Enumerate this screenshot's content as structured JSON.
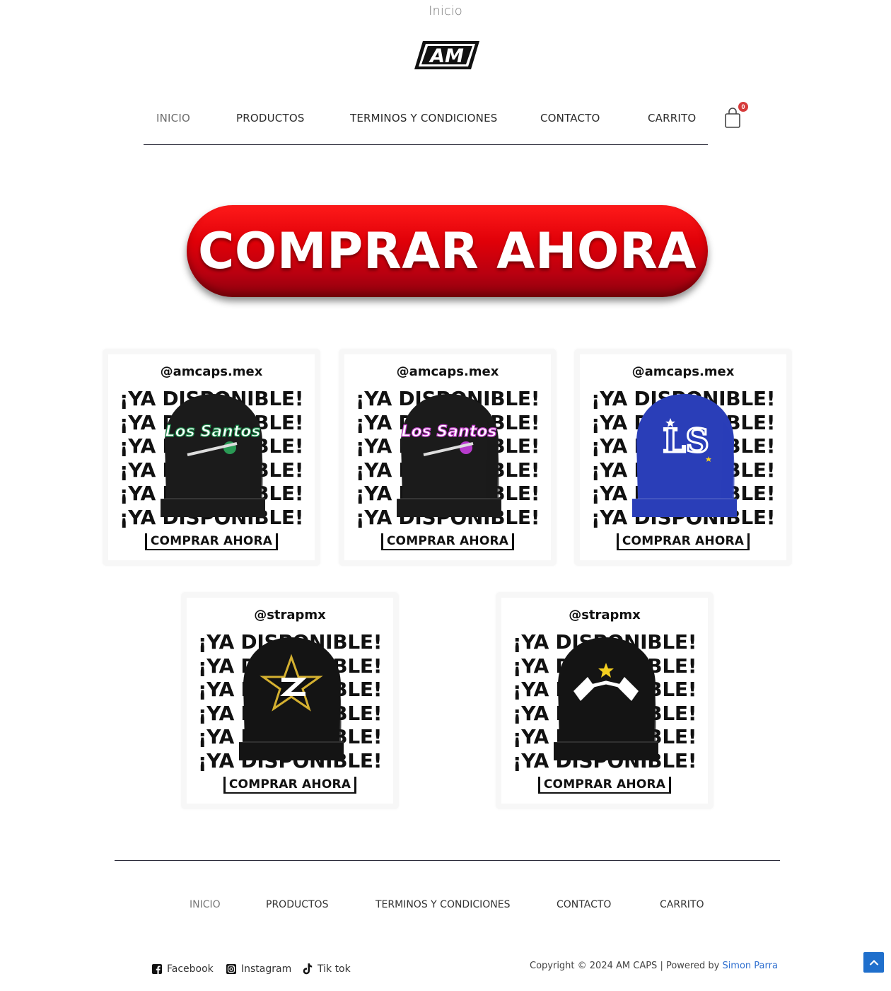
{
  "page_title": "Inicio",
  "logo": {
    "text": "AM"
  },
  "nav": {
    "items": [
      {
        "label": "INICIO",
        "active": true
      },
      {
        "label": "PRODUCTOS",
        "active": false
      },
      {
        "label": "TERMINOS Y CONDICIONES",
        "active": false
      },
      {
        "label": "CONTACTO",
        "active": false
      },
      {
        "label": "CARRITO",
        "active": false
      }
    ],
    "cart_count": "0"
  },
  "cta": {
    "label": "COMPRAR AHORA"
  },
  "cards": [
    {
      "handle": "@amcaps.mex",
      "headline": "¡YA DISPONIBLE!",
      "button": "COMPRAR AHORA",
      "cap": "los-santos-green-cap-icon",
      "cap_color": "#1b1b1b"
    },
    {
      "handle": "@amcaps.mex",
      "headline": "¡YA DISPONIBLE!",
      "button": "COMPRAR AHORA",
      "cap": "los-santos-purple-cap-icon",
      "cap_color": "#1b1b1b"
    },
    {
      "handle": "@amcaps.mex",
      "headline": "¡YA DISPONIBLE!",
      "button": "COMPRAR AHORA",
      "cap": "ls-blue-cap-icon",
      "cap_color": "#2a3eb8"
    },
    {
      "handle": "@strapmx",
      "headline": "¡YA DISPONIBLE!",
      "button": "COMPRAR AHORA",
      "cap": "star-s-black-cap-icon",
      "cap_color": "#141414"
    },
    {
      "handle": "@strapmx",
      "headline": "¡YA DISPONIBLE!",
      "button": "COMPRAR AHORA",
      "cap": "double-star-black-cap-icon",
      "cap_color": "#141414"
    }
  ],
  "footer_nav": {
    "items": [
      {
        "label": "INICIO",
        "active": true
      },
      {
        "label": "PRODUCTOS",
        "active": false
      },
      {
        "label": "TERMINOS Y CONDICIONES",
        "active": false
      },
      {
        "label": "CONTACTO",
        "active": false
      },
      {
        "label": "CARRITO",
        "active": false
      }
    ]
  },
  "social": [
    {
      "label": "Facebook",
      "icon": "facebook-icon"
    },
    {
      "label": "Instagram",
      "icon": "instagram-icon"
    },
    {
      "label": "Tik tok",
      "icon": "tiktok-icon"
    }
  ],
  "copyright": {
    "text": "Copyright © 2024 AM CAPS  | Powered by ",
    "link": "Simon Parra"
  },
  "colors": {
    "accent_red": "#e00008",
    "link_blue": "#2f6fcf",
    "badge_red": "#d63b3b"
  }
}
